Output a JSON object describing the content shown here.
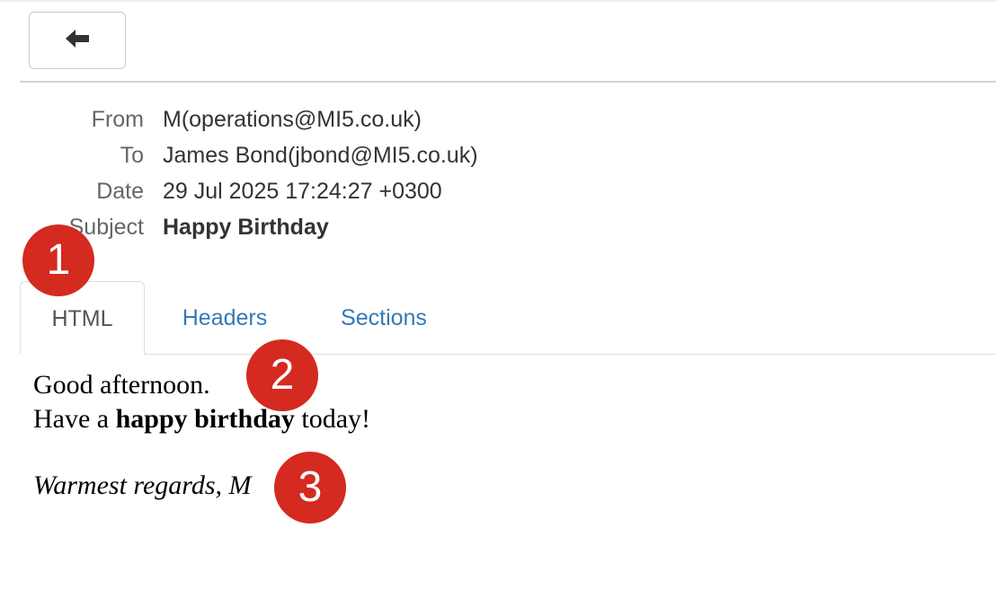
{
  "toolbar": {
    "back_icon": "arrow-left-icon"
  },
  "headers": [
    {
      "label": "From",
      "value": "M(operations@MI5.co.uk)"
    },
    {
      "label": "To",
      "value": "James Bond(jbond@MI5.co.uk)"
    },
    {
      "label": "Date",
      "value": "29 Jul 2025 17:24:27 +0300"
    },
    {
      "label": "Subject",
      "value": "Happy Birthday"
    }
  ],
  "tabs": [
    {
      "label": "HTML",
      "active": true
    },
    {
      "label": "Headers",
      "active": false
    },
    {
      "label": "Sections",
      "active": false
    }
  ],
  "body": {
    "line1": "Good afternoon.",
    "line2_before": "Have a ",
    "line2_bold": "happy birthday",
    "line2_after": " today!",
    "signoff": "Warmest regards, M"
  },
  "markers": [
    "1",
    "2",
    "3"
  ],
  "colors": {
    "link": "#337ab7",
    "marker": "#d42a20"
  }
}
